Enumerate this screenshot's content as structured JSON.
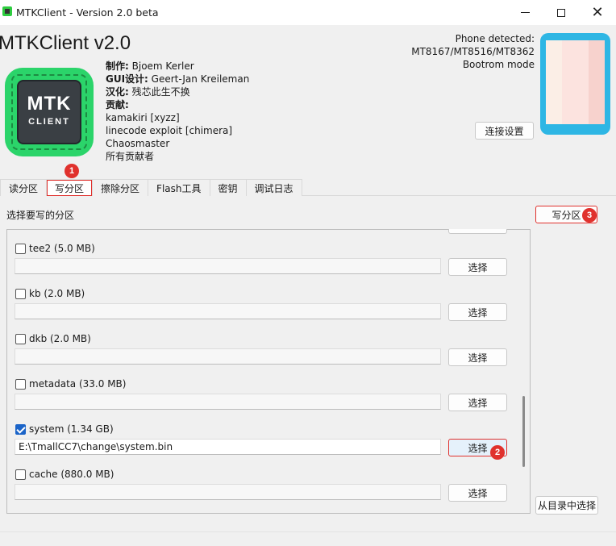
{
  "window": {
    "title": "MTKClient - Version 2.0 beta"
  },
  "header": {
    "app_title": "MTKClient v2.0",
    "logo_text_1": "MTK",
    "logo_text_2": "CLIENT",
    "credits": [
      {
        "label": "制作:",
        "value": " Bjoem Kerler"
      },
      {
        "label": "GUI设计:",
        "value": " Geert-Jan Kreileman"
      },
      {
        "label": "汉化:",
        "value": " 残芯此生不换"
      },
      {
        "label": "贡献:",
        "value": ""
      },
      {
        "label": "",
        "value": "kamakiri [xyzz]"
      },
      {
        "label": "",
        "value": "linecode exploit [chimera]"
      },
      {
        "label": "",
        "value": "Chaosmaster"
      },
      {
        "label": "",
        "value": "所有贡献者"
      }
    ],
    "phone_detected": "Phone detected:",
    "chip_models": "MT8167/MT8516/MT8362",
    "mode": "Bootrom mode",
    "connect_settings_label": "连接设置"
  },
  "tabs": [
    {
      "label": "读分区",
      "active": false
    },
    {
      "label": "写分区",
      "active": true
    },
    {
      "label": "擦除分区",
      "active": false
    },
    {
      "label": "Flash工具",
      "active": false
    },
    {
      "label": "密钥",
      "active": false
    },
    {
      "label": "调试日志",
      "active": false
    }
  ],
  "write_panel": {
    "label": "选择要写的分区",
    "write_button_label": "写分区",
    "from_dir_button_label": "从目录中选择",
    "select_label": "选择",
    "partitions": [
      {
        "name": "tee2 (5.0 MB)",
        "checked": false,
        "path": ""
      },
      {
        "name": "kb (2.0 MB)",
        "checked": false,
        "path": ""
      },
      {
        "name": "dkb (2.0 MB)",
        "checked": false,
        "path": ""
      },
      {
        "name": "metadata (33.0 MB)",
        "checked": false,
        "path": ""
      },
      {
        "name": "system (1.34 GB)",
        "checked": true,
        "path": "E:\\TmallCC7\\change\\system.bin"
      },
      {
        "name": "cache (880.0 MB)",
        "checked": false,
        "path": ""
      }
    ]
  },
  "annotations": [
    "1",
    "2",
    "3"
  ],
  "colors": {
    "annotation_red": "#e0312d",
    "checkbox_blue": "#1b64c8",
    "logo_green": "#2bd46a",
    "phone_blue": "#2eb6e4"
  }
}
